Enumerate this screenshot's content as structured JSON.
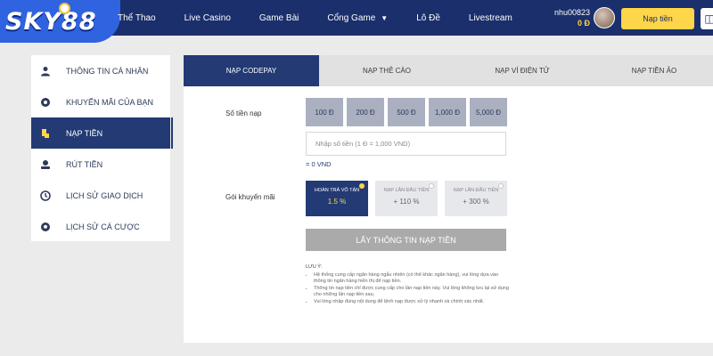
{
  "brand": {
    "logo_text": "SKY88"
  },
  "nav": {
    "items": [
      {
        "label": "Thể Thao"
      },
      {
        "label": "Live Casino"
      },
      {
        "label": "Game Bài"
      },
      {
        "label": "Cổng Game"
      },
      {
        "label": "Lô Đề"
      },
      {
        "label": "Livestream"
      }
    ]
  },
  "user": {
    "username": "nhu00823",
    "balance": "0 Đ",
    "deposit_label": "Nạp tiền"
  },
  "sidebar": {
    "items": [
      {
        "label": "THÔNG TIN CÁ NHÂN",
        "icon": "user-icon"
      },
      {
        "label": "KHUYẾN MÃI CỦA BẠN",
        "icon": "gift-icon"
      },
      {
        "label": "NẠP TIỀN",
        "icon": "deposit-icon"
      },
      {
        "label": "RÚT TIỀN",
        "icon": "withdraw-icon"
      },
      {
        "label": "LỊCH SỬ GIAO DỊCH",
        "icon": "history-icon"
      },
      {
        "label": "LỊCH SỬ CÁ CƯỢC",
        "icon": "ball-icon"
      }
    ],
    "active_index": 2
  },
  "tabs": [
    {
      "label": "NẠP CODEPAY"
    },
    {
      "label": "NẠP THẺ CÀO"
    },
    {
      "label": "NẠP VÍ ĐIỆN TỬ"
    },
    {
      "label": "NẠP TIỀN ẢO"
    }
  ],
  "form": {
    "amount_label": "Số tiền nạp",
    "amounts": [
      "100 Đ",
      "200 Đ",
      "500 Đ",
      "1,000 Đ",
      "5,000 Đ"
    ],
    "amount_placeholder": "Nhập số tiền (1 Đ = 1,000 VND)",
    "conversion": "= 0 VND",
    "promo_label": "Gói khuyến mãi",
    "promos": [
      {
        "name": "HOÀN TRẢ VÔ TẬN",
        "value": "1.5 %",
        "active": true
      },
      {
        "name": "NẠP LẦN ĐẦU TIÊN",
        "value": "+ 110 %",
        "active": false
      },
      {
        "name": "NẠP LẦN ĐẦU TIÊN",
        "value": "+ 300 %",
        "active": false
      }
    ],
    "submit_label": "LẤY THÔNG TIN NẠP TIỀN"
  },
  "notes": {
    "title": "LƯU Ý:",
    "items": [
      "Hệ thống cung cấp ngân hàng ngẫu nhiên (có thể khác ngân hàng), vui lòng dựa vào thông tin ngân hàng hiển thị để nạp tiền.",
      "Thông tin nạp tiền chỉ được cung cấp cho lần nạp tiền này. Vui lòng không lưu lại sử dụng cho những lần nạp tiền sau.",
      "Vui lòng nhập đúng nội dung để lệnh nạp được xử lý nhanh và chính xác nhất."
    ]
  },
  "colors": {
    "nav_bg": "#1a2f6b",
    "brand_blue": "#2f63e0",
    "accent_yellow": "#ffd54a",
    "active_navy": "#233a74",
    "button_gray": "#aaaaaa"
  }
}
